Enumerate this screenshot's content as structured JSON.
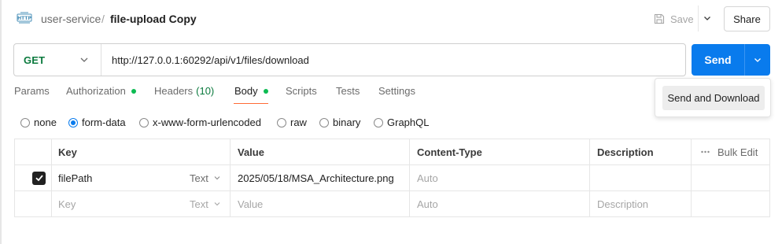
{
  "header": {
    "icon": "http-icon",
    "breadcrumb_parent": "user-service",
    "breadcrumb_separator": "/",
    "breadcrumb_current": "file-upload Copy",
    "save_label": "Save",
    "share_label": "Share"
  },
  "request": {
    "method": "GET",
    "url": "http://127.0.0.1:60292/api/v1/files/download",
    "send_label": "Send",
    "send_menu": [
      "Send and Download"
    ]
  },
  "tabs": [
    {
      "label": "Params",
      "dot": false
    },
    {
      "label": "Authorization",
      "dot": true
    },
    {
      "label": "Headers",
      "count": "(10)",
      "dot": false
    },
    {
      "label": "Body",
      "dot": true,
      "active": true
    },
    {
      "label": "Scripts",
      "dot": false
    },
    {
      "label": "Tests",
      "dot": false
    },
    {
      "label": "Settings",
      "dot": false
    }
  ],
  "body_types": [
    {
      "label": "none",
      "selected": false
    },
    {
      "label": "form-data",
      "selected": true
    },
    {
      "label": "x-www-form-urlencoded",
      "selected": false
    },
    {
      "label": "raw",
      "selected": false
    },
    {
      "label": "binary",
      "selected": false
    },
    {
      "label": "GraphQL",
      "selected": false
    }
  ],
  "table": {
    "columns": [
      "Key",
      "Value",
      "Content-Type",
      "Description"
    ],
    "bulk_edit": "Bulk Edit",
    "rows": [
      {
        "checked": true,
        "key": "filePath",
        "type": "Text",
        "value": "2025/05/18/MSA_Architecture.png",
        "content_type": "Auto",
        "description": ""
      }
    ],
    "placeholder": {
      "key": "Key",
      "type": "Text",
      "value": "Value",
      "content_type": "Auto",
      "description": "Description"
    }
  },
  "colors": {
    "accent": "#097bed",
    "method": "#0b7a3e",
    "active_tab_underline": "#ff6c37",
    "status_dot": "#0cbb52"
  }
}
